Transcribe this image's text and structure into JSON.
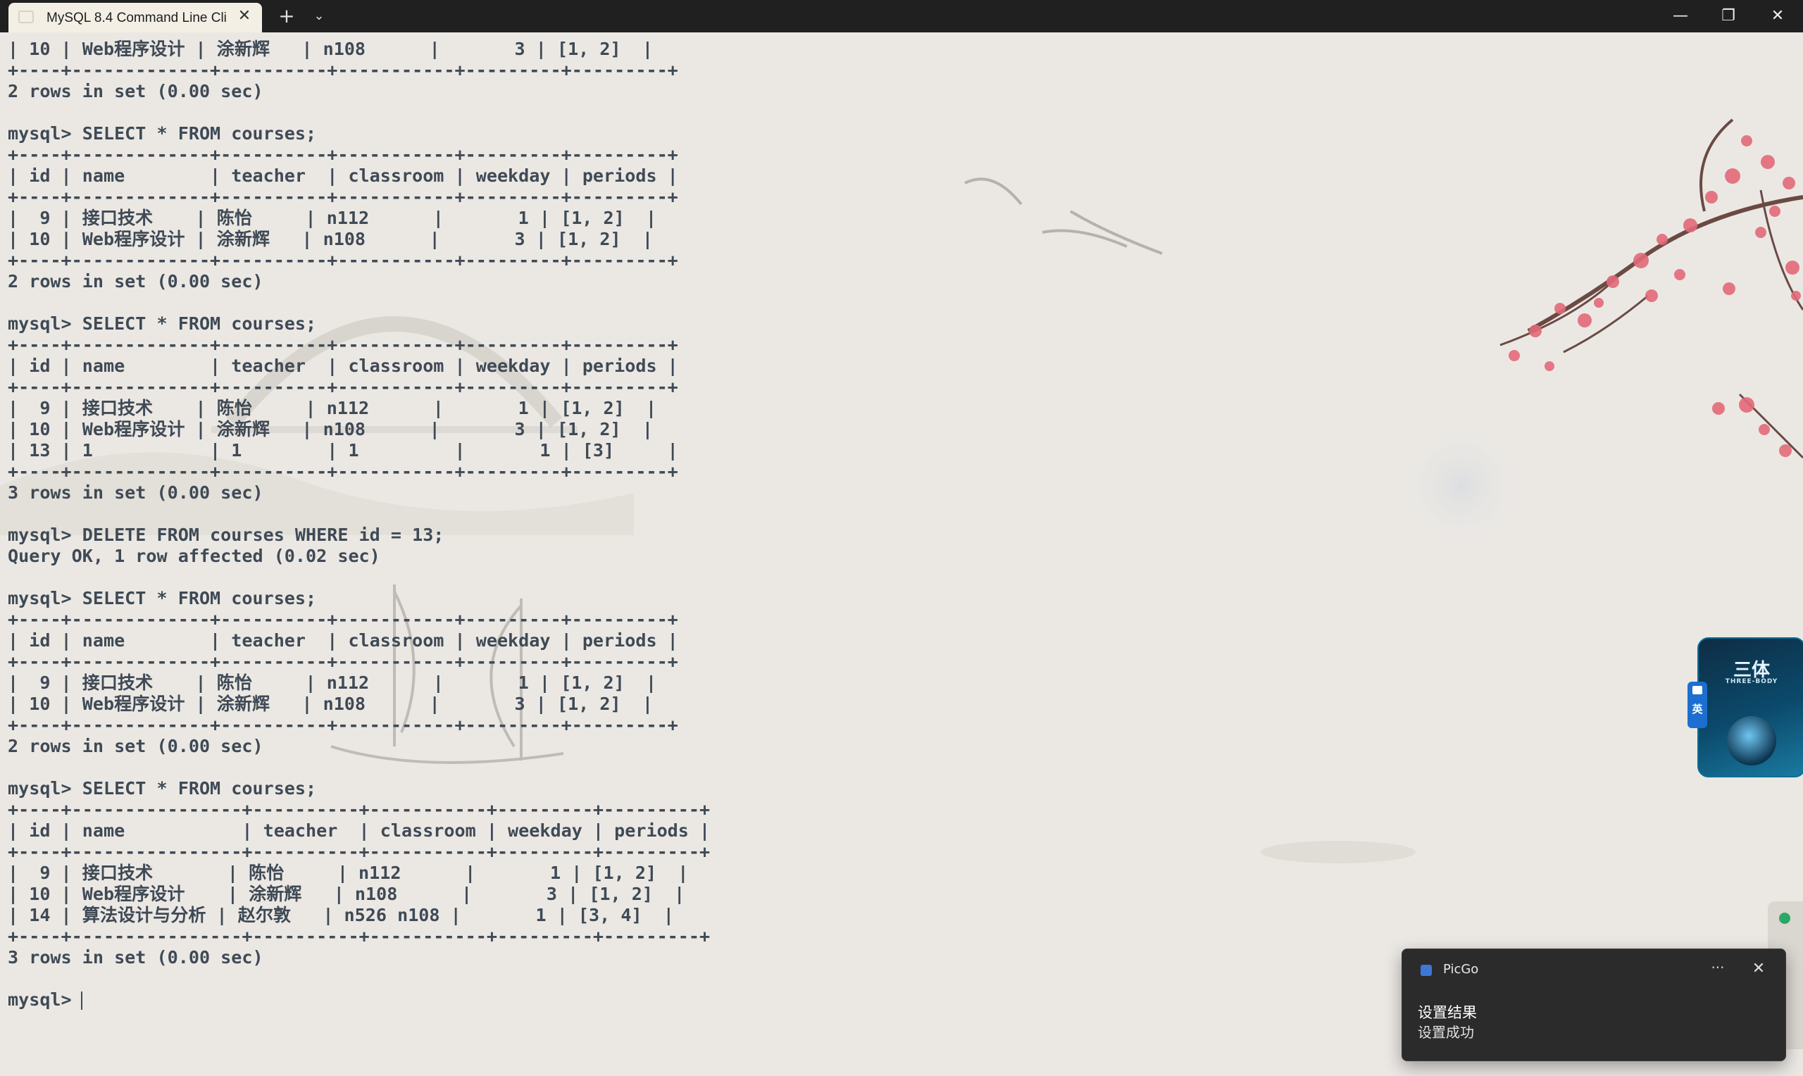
{
  "window": {
    "tab_title": "MySQL 8.4 Command Line Cli",
    "tab_close": "✕",
    "new_tab": "+",
    "tab_dropdown": "⌄",
    "minimize": "—",
    "maximize": "❐",
    "close": "✕"
  },
  "terminal": {
    "text": "| 10 | Web程序设计 | 涂新辉   | n108      |       3 | [1, 2]  |\n+----+-------------+----------+-----------+---------+---------+\n2 rows in set (0.00 sec)\n\nmysql> SELECT * FROM courses;\n+----+-------------+----------+-----------+---------+---------+\n| id | name        | teacher  | classroom | weekday | periods |\n+----+-------------+----------+-----------+---------+---------+\n|  9 | 接口技术    | 陈怡     | n112      |       1 | [1, 2]  |\n| 10 | Web程序设计 | 涂新辉   | n108      |       3 | [1, 2]  |\n+----+-------------+----------+-----------+---------+---------+\n2 rows in set (0.00 sec)\n\nmysql> SELECT * FROM courses;\n+----+-------------+----------+-----------+---------+---------+\n| id | name        | teacher  | classroom | weekday | periods |\n+----+-------------+----------+-----------+---------+---------+\n|  9 | 接口技术    | 陈怡     | n112      |       1 | [1, 2]  |\n| 10 | Web程序设计 | 涂新辉   | n108      |       3 | [1, 2]  |\n| 13 | 1           | 1        | 1         |       1 | [3]     |\n+----+-------------+----------+-----------+---------+---------+\n3 rows in set (0.00 sec)\n\nmysql> DELETE FROM courses WHERE id = 13;\nQuery OK, 1 row affected (0.02 sec)\n\nmysql> SELECT * FROM courses;\n+----+-------------+----------+-----------+---------+---------+\n| id | name        | teacher  | classroom | weekday | periods |\n+----+-------------+----------+-----------+---------+---------+\n|  9 | 接口技术    | 陈怡     | n112      |       1 | [1, 2]  |\n| 10 | Web程序设计 | 涂新辉   | n108      |       3 | [1, 2]  |\n+----+-------------+----------+-----------+---------+---------+\n2 rows in set (0.00 sec)\n\nmysql> SELECT * FROM courses;\n+----+----------------+----------+-----------+---------+---------+\n| id | name           | teacher  | classroom | weekday | periods |\n+----+----------------+----------+-----------+---------+---------+\n|  9 | 接口技术       | 陈怡     | n112      |       1 | [1, 2]  |\n| 10 | Web程序设计    | 涂新辉   | n108      |       3 | [1, 2]  |\n| 14 | 算法设计与分析 | 赵尔敦   | n526 n108 |       1 | [3, 4]  |\n+----+----------------+----------+-----------+---------+---------+\n3 rows in set (0.00 sec)\n\nmysql> ",
    "text_color": "#3f4a55"
  },
  "widget": {
    "title": "三体",
    "subtitle": "THREE-BODY",
    "ime_label": "英"
  },
  "notification": {
    "app": "PicGo",
    "more": "···",
    "close": "✕",
    "title": "设置结果",
    "body": "设置成功"
  },
  "colors": {
    "titlebar": "#202020",
    "tab": "#f3efe4",
    "background": "#ebe8e4",
    "blossom": "#e36a78",
    "toast": "#2b2b2b"
  }
}
